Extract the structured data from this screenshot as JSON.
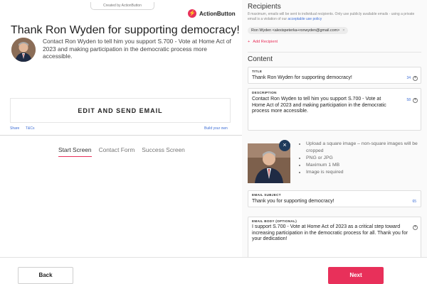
{
  "preview": {
    "created_by": "Created by ActionButton",
    "brand_name": "ActionButton",
    "title": "Thank Ron Wyden for supporting democracy!",
    "description": "Contact Ron Wyden to tell him you support S.700 - Vote at Home Act of 2023 and making participation in the democratic process more accessible.",
    "cta_label": "EDIT AND SEND EMAIL",
    "share_label": "Share",
    "tc_label": "T&Cs",
    "build_label": "Build your own",
    "tabs": [
      {
        "label": "Start Screen",
        "active": true
      },
      {
        "label": "Contact Form",
        "active": false
      },
      {
        "label": "Success Screen",
        "active": false
      }
    ]
  },
  "form": {
    "recipients_heading": "Recipients",
    "recipients_note": "8 maximum, emails will be sent to individual recipients. Only use publicly available emails - using a private email is a violation of our",
    "recipients_note_link": "acceptable use policy",
    "recipient_chip": "Ron Wyden <alexispeterka+ronwyden@gmail.com>",
    "chip_remove": "×",
    "add_recipient": "Add Recipient",
    "content_heading": "Content",
    "title_label": "TITLE",
    "title_value": "Thank Ron Wyden for supporting democracy!",
    "title_count": "34",
    "description_label": "DESCRIPTION",
    "description_value": "Contact Ron Wyden to tell him you support S.700 - Vote at Home Act of 2023 and making participation in the democratic process more accessible.",
    "description_count": "58",
    "photo_rules": [
      "Upload a square image – non-square images will be cropped",
      "PNG or JPG",
      "Maximum 1 MB",
      "Image is required"
    ],
    "subject_label": "EMAIL SUBJECT",
    "subject_value": "Thank you for supporting democracy!",
    "subject_count": "65",
    "body_label": "EMAIL BODY (OPTIONAL)",
    "body_value": "I support S.700 - Vote at Home Act of 2023 as a critical step toward increasing participation in the democratic process for all. Thank you for your dedication!"
  },
  "footer": {
    "back_label": "Back",
    "next_label": "Next"
  },
  "colors": {
    "accent": "#e8305a",
    "link": "#3f6fd6",
    "photo_badge": "#1f3b5c"
  },
  "icons": {
    "brand": "lightning-bolt-icon",
    "add": "plus-icon",
    "edit_photo": "close-icon",
    "field_action": "plus-circle-icon"
  }
}
